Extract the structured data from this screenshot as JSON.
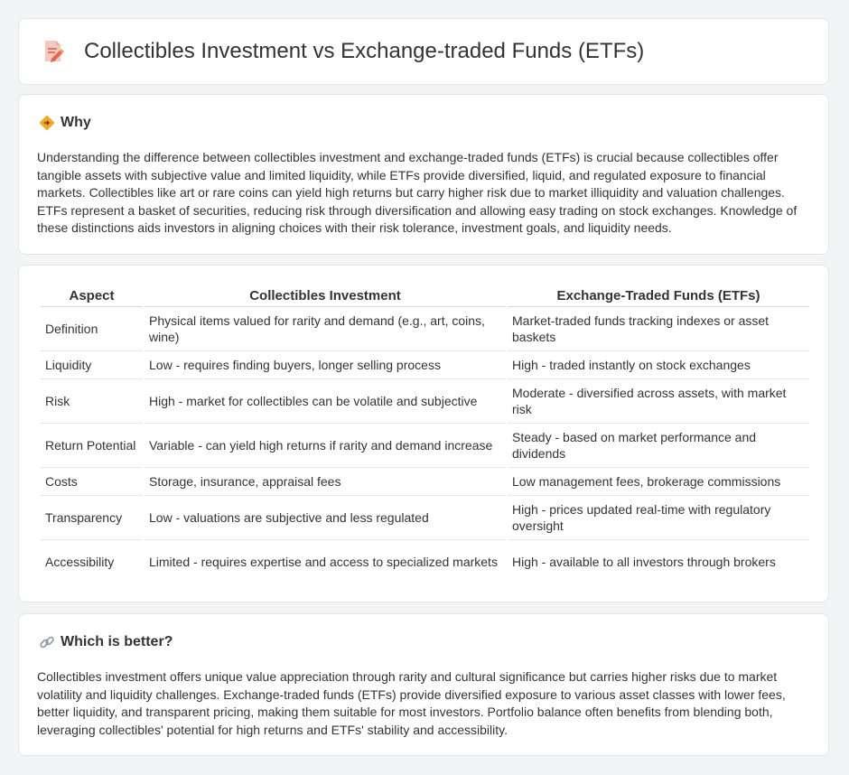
{
  "header": {
    "title": "Collectibles Investment vs Exchange-traded Funds (ETFs)",
    "icon": "document-edit-icon"
  },
  "why": {
    "heading": "Why",
    "icon": "diamond-sign-icon",
    "text": "Understanding the difference between collectibles investment and exchange-traded funds (ETFs) is crucial because collectibles offer tangible assets with subjective value and limited liquidity, while ETFs provide diversified, liquid, and regulated exposure to financial markets. Collectibles like art or rare coins can yield high returns but carry higher risk due to market illiquidity and valuation challenges. ETFs represent a basket of securities, reducing risk through diversification and allowing easy trading on stock exchanges. Knowledge of these distinctions aids investors in aligning choices with their risk tolerance, investment goals, and liquidity needs."
  },
  "table": {
    "headers": [
      "Aspect",
      "Collectibles Investment",
      "Exchange-Traded Funds (ETFs)"
    ],
    "rows": [
      [
        "Definition",
        "Physical items valued for rarity and demand (e.g., art, coins, wine)",
        "Market-traded funds tracking indexes or asset baskets"
      ],
      [
        "Liquidity",
        "Low - requires finding buyers, longer selling process",
        "High - traded instantly on stock exchanges"
      ],
      [
        "Risk",
        "High - market for collectibles can be volatile and subjective",
        "Moderate - diversified across assets, with market risk"
      ],
      [
        "Return Potential",
        "Variable - can yield high returns if rarity and demand increase",
        "Steady - based on market performance and dividends"
      ],
      [
        "Costs",
        "Storage, insurance, appraisal fees",
        "Low management fees, brokerage commissions"
      ],
      [
        "Transparency",
        "Low - valuations are subjective and less regulated",
        "High - prices updated real-time with regulatory oversight"
      ],
      [
        "Accessibility",
        "Limited - requires expertise and access to specialized markets",
        "High - available to all investors through brokers"
      ]
    ]
  },
  "better": {
    "heading": "Which is better?",
    "icon": "link-icon",
    "text": "Collectibles investment offers unique value appreciation through rarity and cultural significance but carries higher risks due to market volatility and liquidity challenges. Exchange-traded funds (ETFs) provide diversified exposure to various asset classes with lower fees, better liquidity, and transparent pricing, making them suitable for most investors. Portfolio balance often benefits from blending both, leveraging collectibles' potential for high returns and ETFs' stability and accessibility."
  }
}
